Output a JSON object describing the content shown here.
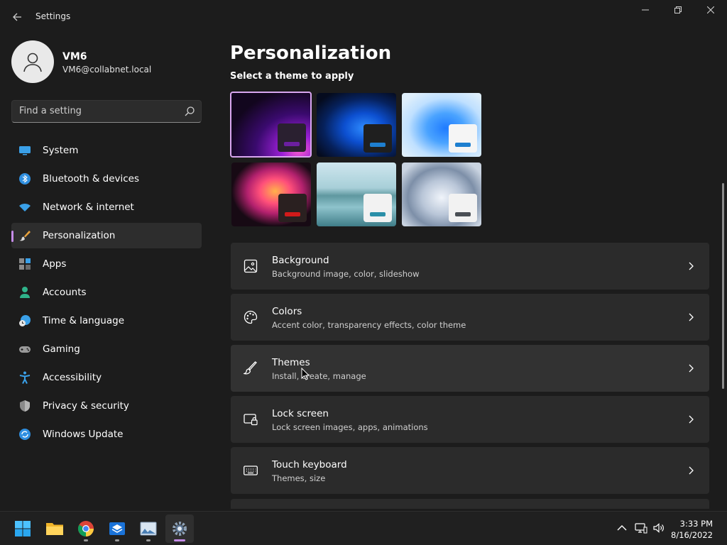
{
  "window": {
    "title": "Settings",
    "back_icon": "back-arrow-icon",
    "controls": [
      "minimize-icon",
      "restore-icon",
      "close-icon"
    ]
  },
  "profile": {
    "name": "VM6",
    "email": "VM6@collabnet.local"
  },
  "search": {
    "placeholder": "Find a setting",
    "value": ""
  },
  "sidebar": {
    "items": [
      {
        "label": "System",
        "icon": "monitor-icon",
        "active": false
      },
      {
        "label": "Bluetooth & devices",
        "icon": "bluetooth-icon",
        "active": false
      },
      {
        "label": "Network & internet",
        "icon": "wifi-icon",
        "active": false
      },
      {
        "label": "Personalization",
        "icon": "brush-icon",
        "active": true
      },
      {
        "label": "Apps",
        "icon": "apps-icon",
        "active": false
      },
      {
        "label": "Accounts",
        "icon": "person-icon",
        "active": false
      },
      {
        "label": "Time & language",
        "icon": "clock-globe-icon",
        "active": false
      },
      {
        "label": "Gaming",
        "icon": "gamepad-icon",
        "active": false
      },
      {
        "label": "Accessibility",
        "icon": "accessibility-icon",
        "active": false
      },
      {
        "label": "Privacy & security",
        "icon": "shield-icon",
        "active": false
      },
      {
        "label": "Windows Update",
        "icon": "update-icon",
        "active": false
      }
    ]
  },
  "main": {
    "title": "Personalization",
    "theme_section_label": "Select a theme to apply",
    "themes": [
      {
        "name": "theme-glow",
        "accent": "#6b1fa0",
        "selected": true
      },
      {
        "name": "theme-windows-dark",
        "accent": "#1e7fd0",
        "selected": false
      },
      {
        "name": "theme-windows-light",
        "accent": "#1e7fd0",
        "selected": false
      },
      {
        "name": "theme-captured-motion",
        "accent": "#d11a1a",
        "selected": false
      },
      {
        "name": "theme-sunrise",
        "accent": "#2a8fa8",
        "selected": false
      },
      {
        "name": "theme-flow",
        "accent": "#4a4f55",
        "selected": false
      }
    ],
    "settings": [
      {
        "title": "Background",
        "subtitle": "Background image, color, slideshow",
        "icon": "image-icon"
      },
      {
        "title": "Colors",
        "subtitle": "Accent color, transparency effects, color theme",
        "icon": "palette-icon"
      },
      {
        "title": "Themes",
        "subtitle": "Install, create, manage",
        "icon": "brush-icon"
      },
      {
        "title": "Lock screen",
        "subtitle": "Lock screen images, apps, animations",
        "icon": "lock-screen-icon"
      },
      {
        "title": "Touch keyboard",
        "subtitle": "Themes, size",
        "icon": "keyboard-icon"
      }
    ]
  },
  "taskbar": {
    "apps": [
      "start-icon",
      "file-explorer-icon",
      "chrome-icon",
      "sandbox-icon",
      "image-viewer-icon",
      "settings-gear-icon"
    ],
    "tray": [
      "chevron-up-icon",
      "network-icon",
      "volume-icon"
    ],
    "time": "3:33 PM",
    "date": "8/16/2022"
  },
  "colors": {
    "background": "#1c1c1c",
    "card": "#2b2b2b",
    "accent": "#c58be8"
  }
}
